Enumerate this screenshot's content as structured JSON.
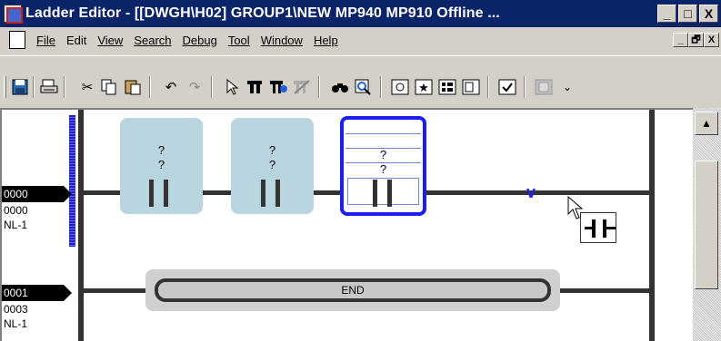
{
  "window": {
    "title": "Ladder Editor - [[DWGH\\H02]    GROUP1\\NEW  MP940  MP910     Offline ...",
    "controls": {
      "minimize": "_",
      "maximize": "□",
      "close": "X"
    }
  },
  "menubar": {
    "items": [
      {
        "label": "File",
        "accel": "F"
      },
      {
        "label": "Edit",
        "accel": ""
      },
      {
        "label": "View",
        "accel": "V"
      },
      {
        "label": "Search",
        "accel": "S"
      },
      {
        "label": "Debug",
        "accel": "D"
      },
      {
        "label": "Tool",
        "accel": "T"
      },
      {
        "label": "Window",
        "accel": "W"
      },
      {
        "label": "Help",
        "accel": "H"
      }
    ],
    "mdi_controls": {
      "minimize": "_",
      "restore": "🗗",
      "close": "X"
    }
  },
  "toolbar": {
    "icons": [
      "save-icon",
      "print-icon",
      "cut-icon",
      "copy-icon",
      "paste-icon",
      "undo-icon",
      "redo-icon",
      "pointer-icon",
      "insert-column-icon",
      "insert-row-icon",
      "delete-icon",
      "find-icon",
      "zoom-icon",
      "coil-icon",
      "star-icon",
      "list-icon",
      "block-icon",
      "check-icon",
      "disabled-icon",
      "more-icon"
    ]
  },
  "ladder": {
    "rungs": [
      {
        "step": "0000",
        "line": "0000",
        "label": "NL-1",
        "contacts": [
          {
            "line1": "?",
            "line2": "?",
            "selected": false
          },
          {
            "line1": "?",
            "line2": "?",
            "selected": false
          },
          {
            "line1": "?",
            "line2": "?",
            "selected": true
          }
        ]
      },
      {
        "step": "0001",
        "line": "0003",
        "label": "NL-1",
        "instruction": "END"
      }
    ],
    "insert_marker": "v"
  }
}
